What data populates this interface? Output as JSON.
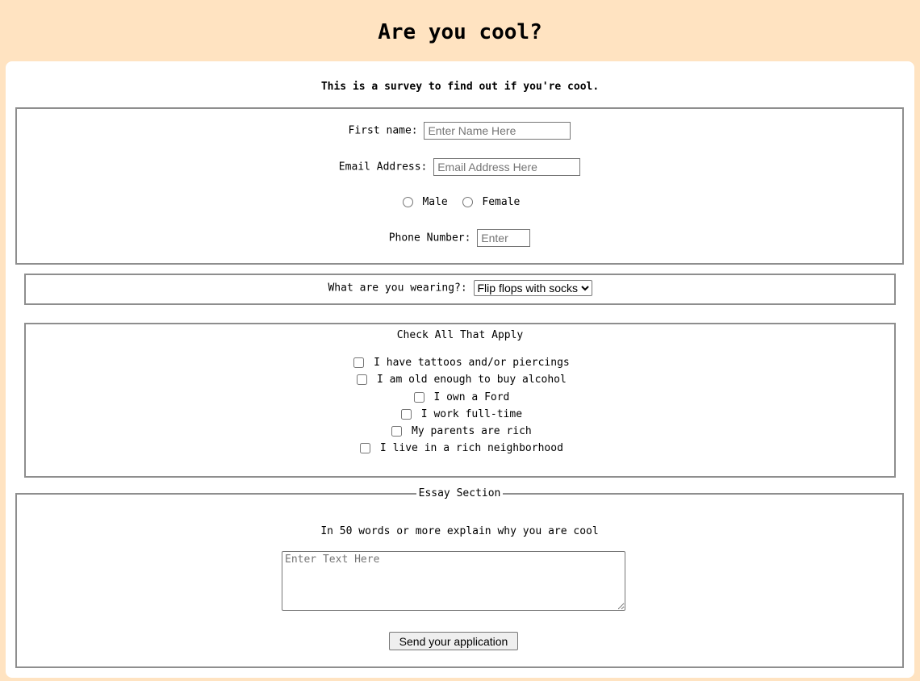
{
  "page": {
    "title": "Are you cool?",
    "intro": "This is a survey to find out if you're cool."
  },
  "personal": {
    "first_name_label": "First name:",
    "first_name_placeholder": "Enter Name Here",
    "email_label": "Email Address:",
    "email_placeholder": "Email Address Here",
    "gender_options": [
      "Male",
      "Female"
    ],
    "phone_label": "Phone Number:",
    "phone_placeholder": "Enter"
  },
  "wearing": {
    "label": "What are you wearing?:",
    "selected": "Flip flops with socks"
  },
  "checks": {
    "title": "Check All That Apply",
    "items": [
      "I have tattoos and/or piercings",
      "I am old enough to buy alcohol",
      "I own a Ford",
      "I work full-time",
      "My parents are rich",
      "I live in a rich neighborhood"
    ]
  },
  "essay": {
    "legend": "Essay Section",
    "prompt": "In 50 words or more explain why you are cool",
    "placeholder": "Enter Text Here",
    "submit_label": "Send your application"
  }
}
